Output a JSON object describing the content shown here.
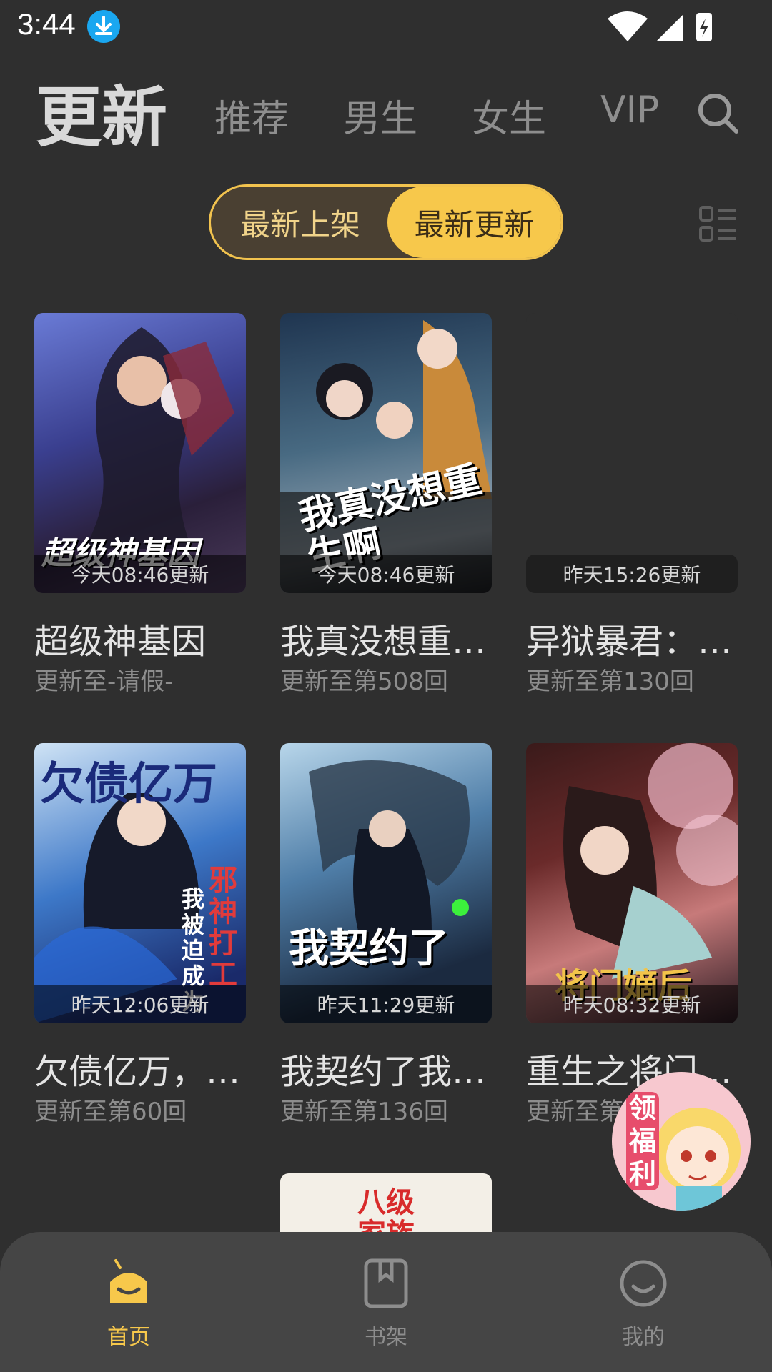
{
  "status_bar": {
    "time": "3:44"
  },
  "top_tabs": {
    "main": "更新",
    "tabs": [
      "推荐",
      "男生",
      "女生",
      "VIP"
    ]
  },
  "segment": {
    "left": "最新上架",
    "right": "最新更新"
  },
  "cards": [
    {
      "title": "超级神基因",
      "sub": "更新至-请假-",
      "update": "今天08:46更新"
    },
    {
      "title": "我真没想重…",
      "sub": "更新至第508回",
      "update": "今天08:46更新"
    },
    {
      "title": "异狱暴君：…",
      "sub": "更新至第130回",
      "update": "昨天15:26更新"
    },
    {
      "title": "欠债亿万，…",
      "sub": "更新至第60回",
      "update": "昨天12:06更新"
    },
    {
      "title": "我契约了我…",
      "sub": "更新至第136回",
      "update": "昨天11:29更新"
    },
    {
      "title": "重生之将门…",
      "sub": "更新至第",
      "update": "昨天08:32更新"
    }
  ],
  "covers": {
    "c1": "超级神基因",
    "c2": "我真没想重生啊",
    "c4a": "欠债亿万",
    "c4b": "邪神打工",
    "c4c": "我被迫成为",
    "c5": "我契约了",
    "c6": "将门嫡后"
  },
  "floating": {
    "label": "领福利"
  },
  "partial": {
    "text1": "八级",
    "text2": "家族"
  },
  "bottom_nav": [
    {
      "label": "首页",
      "color": "#f7c84b"
    },
    {
      "label": "书架",
      "color": "#8d8d8d"
    },
    {
      "label": "我的",
      "color": "#8d8d8d"
    }
  ]
}
